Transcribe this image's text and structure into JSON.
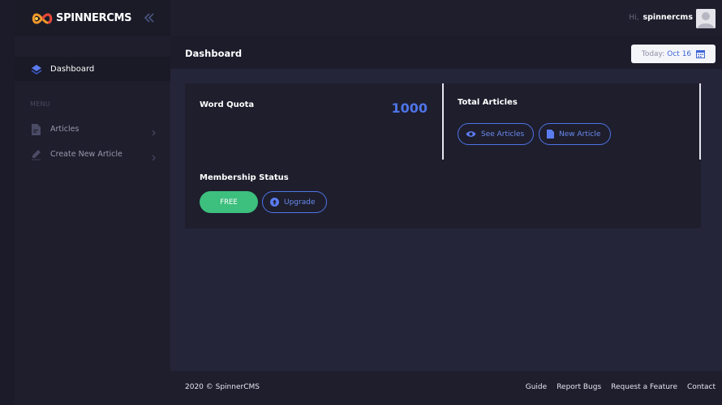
{
  "brand": {
    "name": "SPINNERCMS"
  },
  "sidebar": {
    "dashboard_label": "Dashboard",
    "menu_heading": "MENU",
    "items": [
      {
        "label": "Articles",
        "icon": "document-icon"
      },
      {
        "label": "Create New Article",
        "icon": "pencil-icon"
      }
    ]
  },
  "header": {
    "greeting": "Hi,",
    "username": "spinnercms"
  },
  "subheader": {
    "title": "Dashboard",
    "date_label": "Today:",
    "date_value": "Oct 16"
  },
  "main": {
    "word_quota": {
      "title": "Word Quota",
      "value": "1000"
    },
    "total_articles": {
      "title": "Total Articles",
      "see_label": "See Articles",
      "new_label": "New Article"
    },
    "membership": {
      "title": "Membership Status",
      "status": "FREE",
      "upgrade_label": "Upgrade"
    }
  },
  "footer": {
    "copyright": "2020 © SpinnerCMS",
    "links": [
      "Guide",
      "Report Bugs",
      "Request a Feature",
      "Contact"
    ]
  },
  "colors": {
    "accent": "#4e74e6",
    "success": "#3dbf7e",
    "sidebar_bg": "#1e1e2d",
    "content_bg": "#25253a"
  }
}
